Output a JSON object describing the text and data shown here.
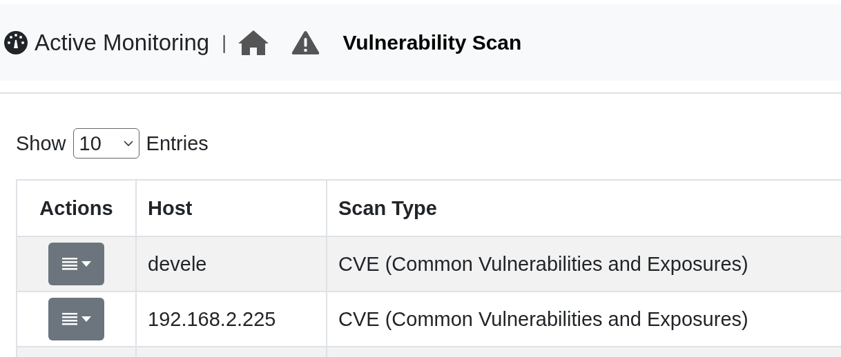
{
  "breadcrumb": {
    "section": "Active Monitoring",
    "separator": "|",
    "current": "Vulnerability Scan"
  },
  "length_control": {
    "before": "Show",
    "value": "10",
    "after": "Entries"
  },
  "table": {
    "columns": [
      "Actions",
      "Host",
      "Scan Type"
    ],
    "rows": [
      {
        "host": "devele",
        "scan_type": "CVE (Common Vulnerabilities and Exposures)"
      },
      {
        "host": "192.168.2.225",
        "scan_type": "CVE (Common Vulnerabilities and Exposures)"
      }
    ]
  }
}
